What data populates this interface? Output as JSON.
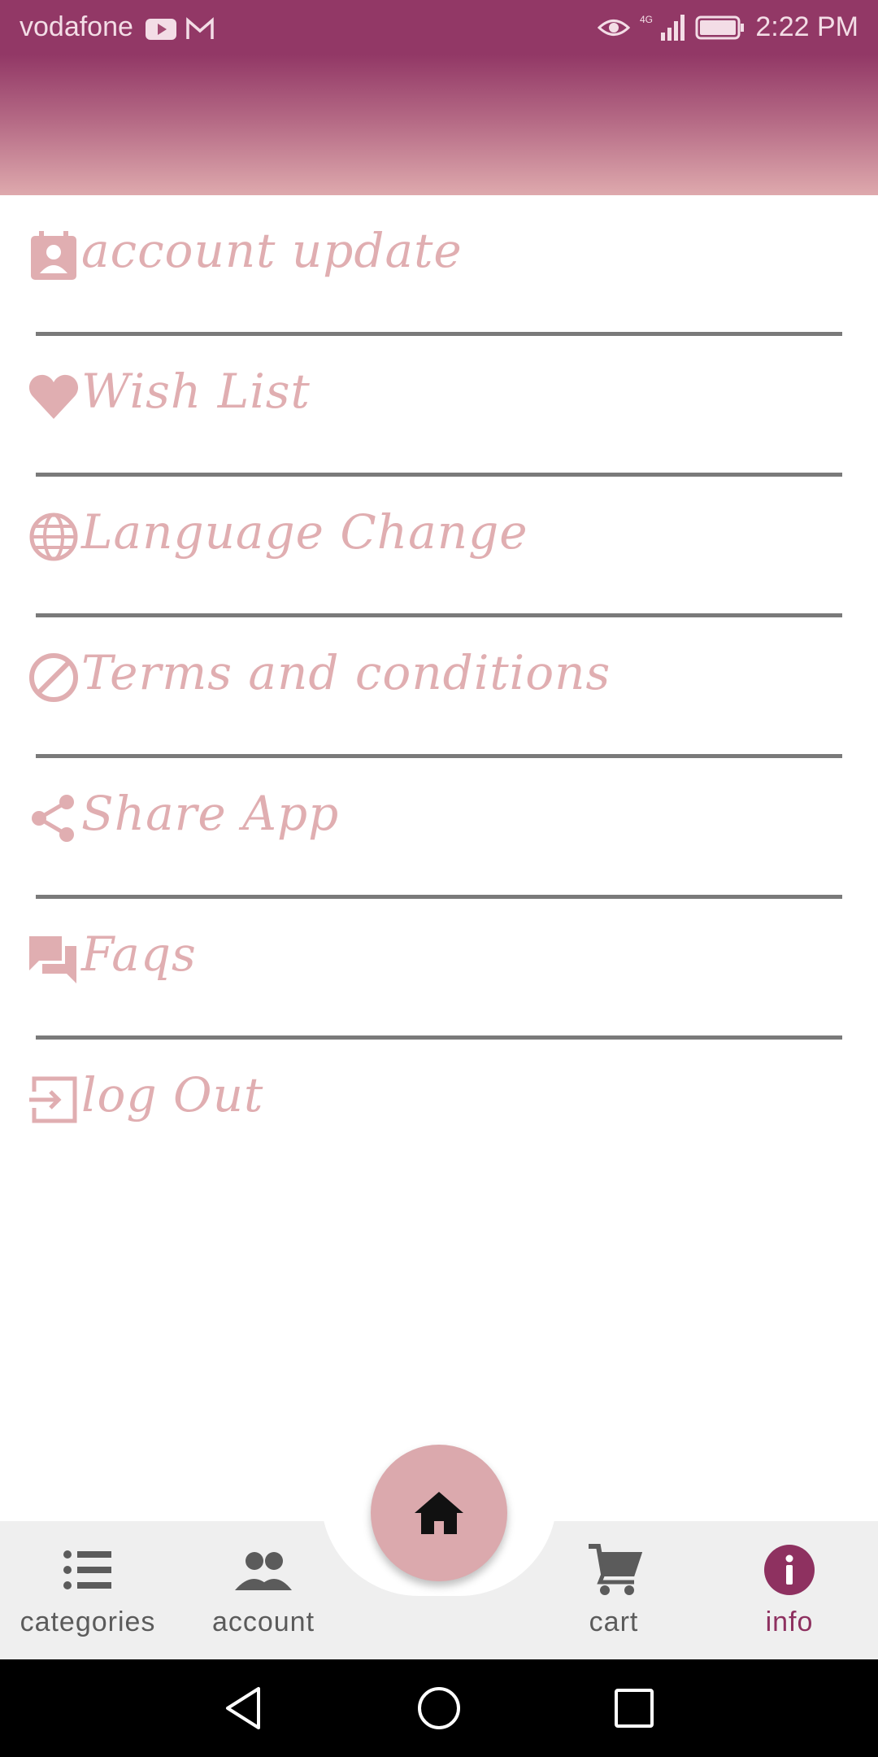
{
  "status_bar": {
    "carrier": "vodafone",
    "network": "4G",
    "time": "2:22 PM",
    "icons": [
      "youtube-icon",
      "gmail-icon",
      "eye-comfort-icon",
      "signal-icon",
      "battery-icon"
    ]
  },
  "menu": {
    "items": [
      {
        "label": "account update",
        "icon": "account-box-icon"
      },
      {
        "label": "Wish List",
        "icon": "heart-icon"
      },
      {
        "label": "Language Change",
        "icon": "globe-icon"
      },
      {
        "label": "Terms and conditions",
        "icon": "block-icon"
      },
      {
        "label": "Share App",
        "icon": "share-icon"
      },
      {
        "label": "Faqs",
        "icon": "forum-icon"
      },
      {
        "label": "log Out",
        "icon": "exit-icon"
      }
    ]
  },
  "bottom_nav": {
    "items": [
      {
        "label": "categories",
        "icon": "list-icon"
      },
      {
        "label": "account",
        "icon": "people-icon"
      },
      {
        "label": "cart",
        "icon": "cart-icon"
      },
      {
        "label": "info",
        "icon": "info-icon",
        "active": true
      }
    ],
    "fab_icon": "home-icon"
  },
  "colors": {
    "header_top": "#923866",
    "header_bottom": "#dea9ad",
    "menu_text": "#e0aeb1",
    "divider": "#7a7a7a",
    "fab": "#dba9ad",
    "active_nav": "#8e3160"
  }
}
